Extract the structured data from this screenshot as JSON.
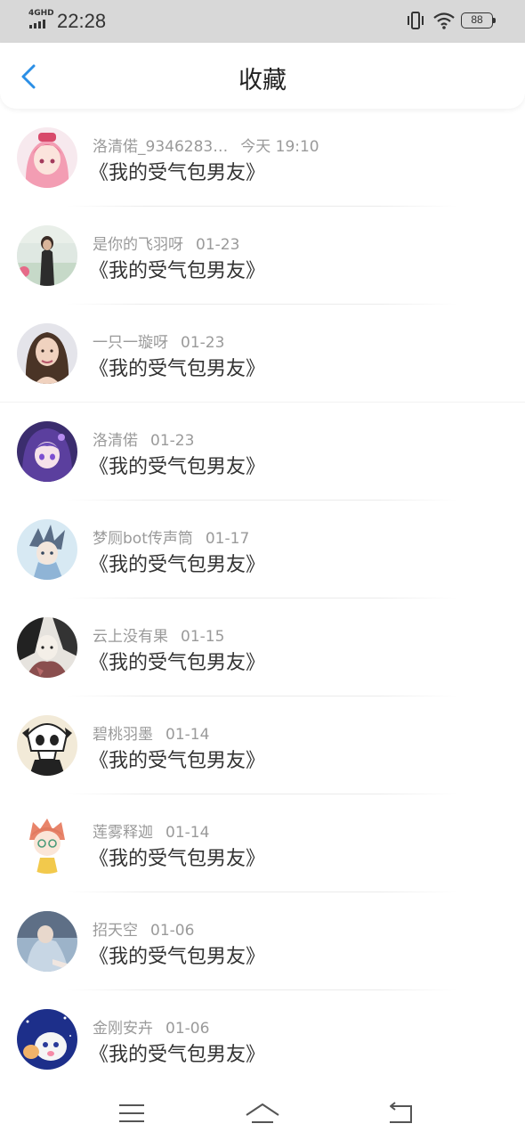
{
  "status_bar": {
    "network": "4GHD",
    "time": "22:28",
    "battery": "88",
    "icons": [
      "signal-icon",
      "vibrate-icon",
      "wifi-icon",
      "battery-icon"
    ]
  },
  "header": {
    "title": "收藏",
    "back_icon": "chevron-left-icon",
    "accent_color": "#2b8fe6"
  },
  "list": [
    {
      "author": "洛清偌_9346283…",
      "time": "今天 19:10",
      "title": "《我的受气包男友》"
    },
    {
      "author": "是你的飞羽呀",
      "time": "01-23",
      "title": "《我的受气包男友》"
    },
    {
      "author": "一只一璇呀",
      "time": "01-23",
      "title": "《我的受气包男友》"
    },
    {
      "author": "洛清偌",
      "time": "01-23",
      "title": "《我的受气包男友》"
    },
    {
      "author": "梦厕bot传声筒",
      "time": "01-17",
      "title": "《我的受气包男友》"
    },
    {
      "author": "云上没有果",
      "time": "01-15",
      "title": "《我的受气包男友》"
    },
    {
      "author": "碧桃羽墨",
      "time": "01-14",
      "title": "《我的受气包男友》"
    },
    {
      "author": "莲雾释迦",
      "time": "01-14",
      "title": "《我的受气包男友》"
    },
    {
      "author": "招天空",
      "time": "01-06",
      "title": "《我的受气包男友》"
    },
    {
      "author": "金刚安卉",
      "time": "01-06",
      "title": "《我的受气包男友》"
    }
  ],
  "nav_bar": {
    "icons": [
      "menu-icon",
      "home-icon",
      "back-icon"
    ]
  }
}
